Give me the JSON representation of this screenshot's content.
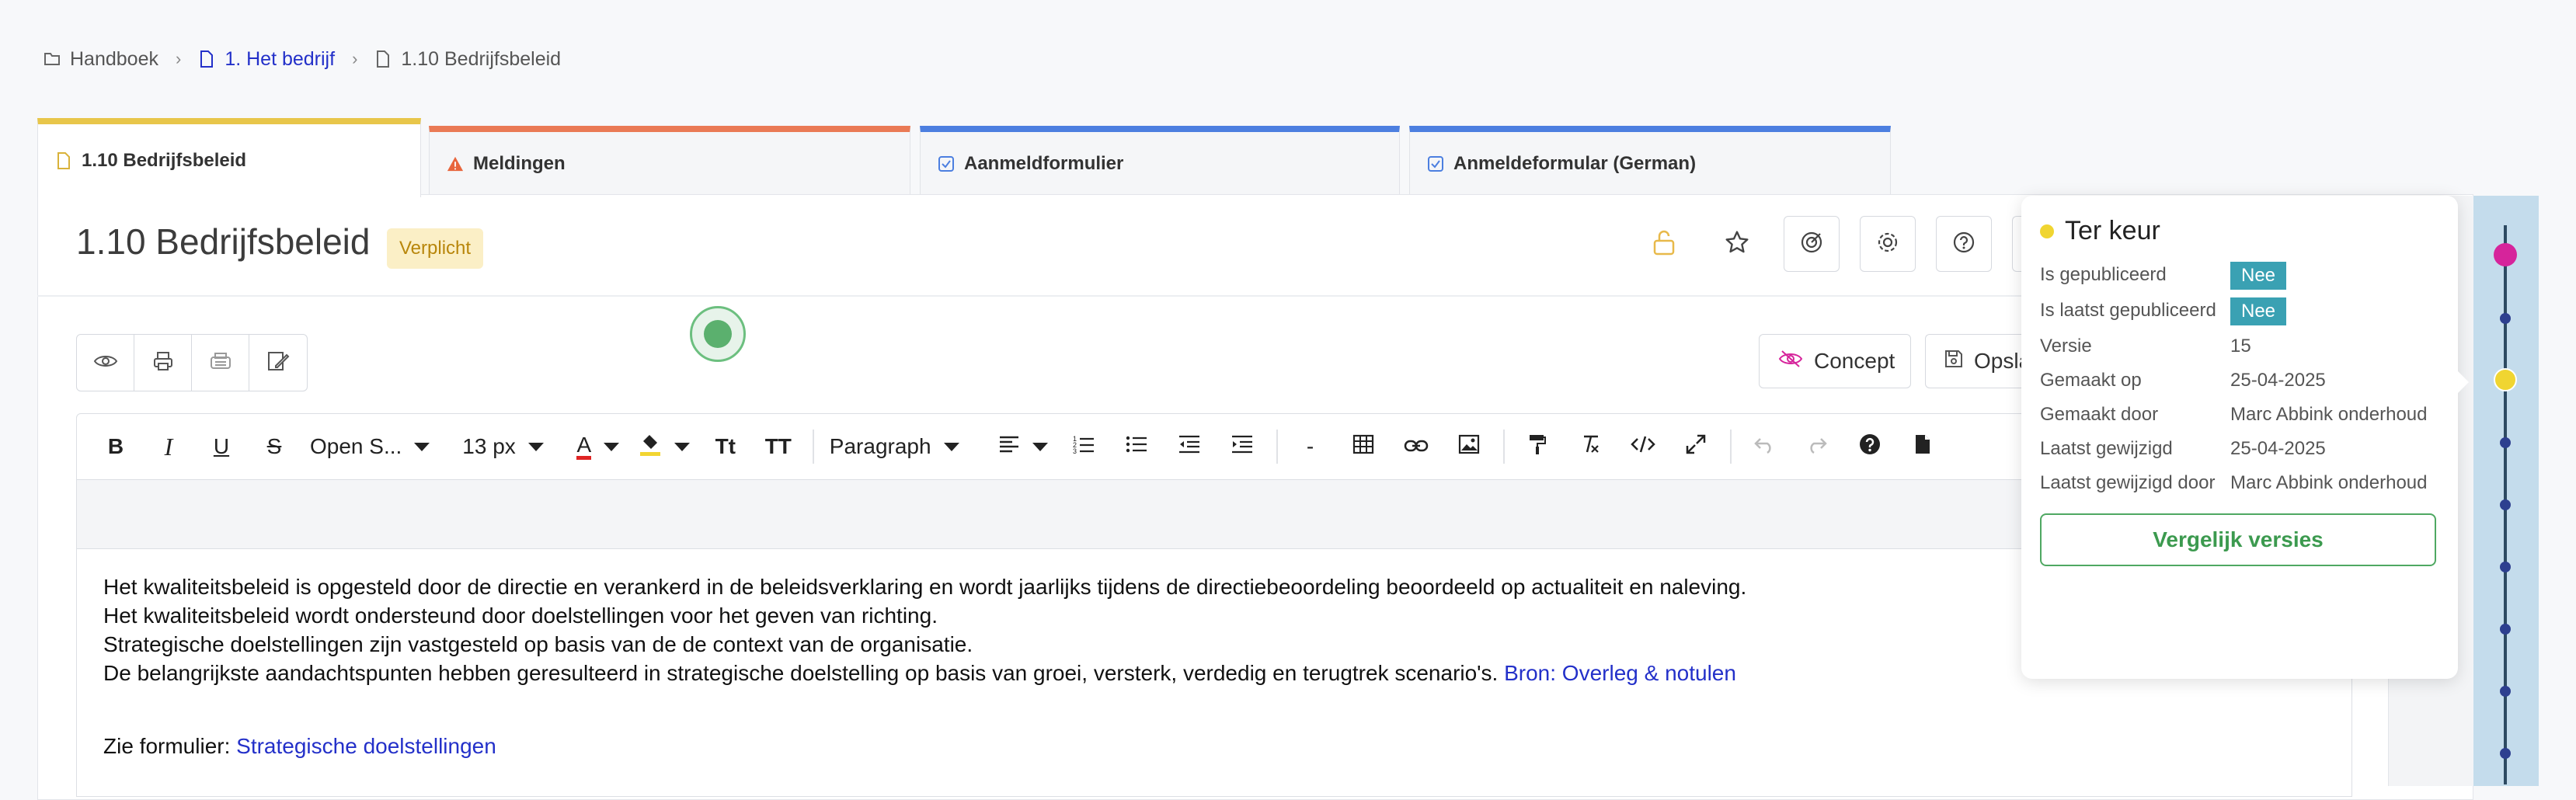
{
  "breadcrumb": {
    "items": [
      "Handboek",
      "1. Het bedrijf",
      "1.10 Bedrijfsbeleid"
    ]
  },
  "tabs": [
    {
      "label": "1.10 Bedrijfsbeleid",
      "accent": "#e8c64a",
      "icon": "document-icon",
      "active": true
    },
    {
      "label": "Meldingen",
      "accent": "#ea7a55",
      "icon": "warning-icon"
    },
    {
      "label": "Aanmeldformulier",
      "accent": "#4c7fe0",
      "icon": "checkbox-icon"
    },
    {
      "label": "Anmeldeformular (German)",
      "accent": "#4c7fe0",
      "icon": "checkbox-icon"
    }
  ],
  "document": {
    "title": "1.10 Bedrijfsbeleid",
    "badge": "Verplicht"
  },
  "actions": {
    "concept_label": "Concept",
    "save_label": "Opsla"
  },
  "editor_toolbar": {
    "font_family": "Open S...",
    "font_size": "13 px",
    "block_format": "Paragraph",
    "hr_label": "-"
  },
  "content": {
    "lines": [
      "Het kwaliteitsbeleid is opgesteld door de directie en verankerd in de beleidsverklaring en wordt jaarlijks tijdens de directiebeoordeling beoordeeld op actualiteit en naleving.",
      "Het kwaliteitsbeleid wordt ondersteund door doelstellingen voor het geven van richting.",
      "Strategische doelstellingen zijn vastgesteld op basis van de de context van de organisatie.",
      "De belangrijkste aandachtspunten hebben geresulteerd in strategische doelstelling op basis van groei, versterk, verdedig en terugtrek scenario's. "
    ],
    "source_link": "Bron: Overleg & notulen",
    "see_prefix": "Zie formulier: ",
    "see_link": "Strategische doelstellingen"
  },
  "version_popover": {
    "status": "Ter keur",
    "rows": [
      {
        "key": "Is gepubliceerd",
        "value": "Nee",
        "tag": true
      },
      {
        "key": "Is laatst gepubliceerd",
        "value": "Nee",
        "tag": true
      },
      {
        "key": "Versie",
        "value": "15"
      },
      {
        "key": "Gemaakt op",
        "value": "25-04-2025"
      },
      {
        "key": "Gemaakt door",
        "value": "Marc Abbink onderhoud"
      },
      {
        "key": "Laatst gewijzigd",
        "value": "25-04-2025"
      },
      {
        "key": "Laatst gewijzigd door",
        "value": "Marc Abbink onderhoud"
      }
    ],
    "compare_label": "Vergelijk versies"
  },
  "colors": {
    "link": "#2330c9",
    "status_yellow": "#f0d531",
    "timeline_magenta": "#d6249b",
    "tag_teal": "#3aa1b3",
    "compare_green": "#4fa862"
  }
}
